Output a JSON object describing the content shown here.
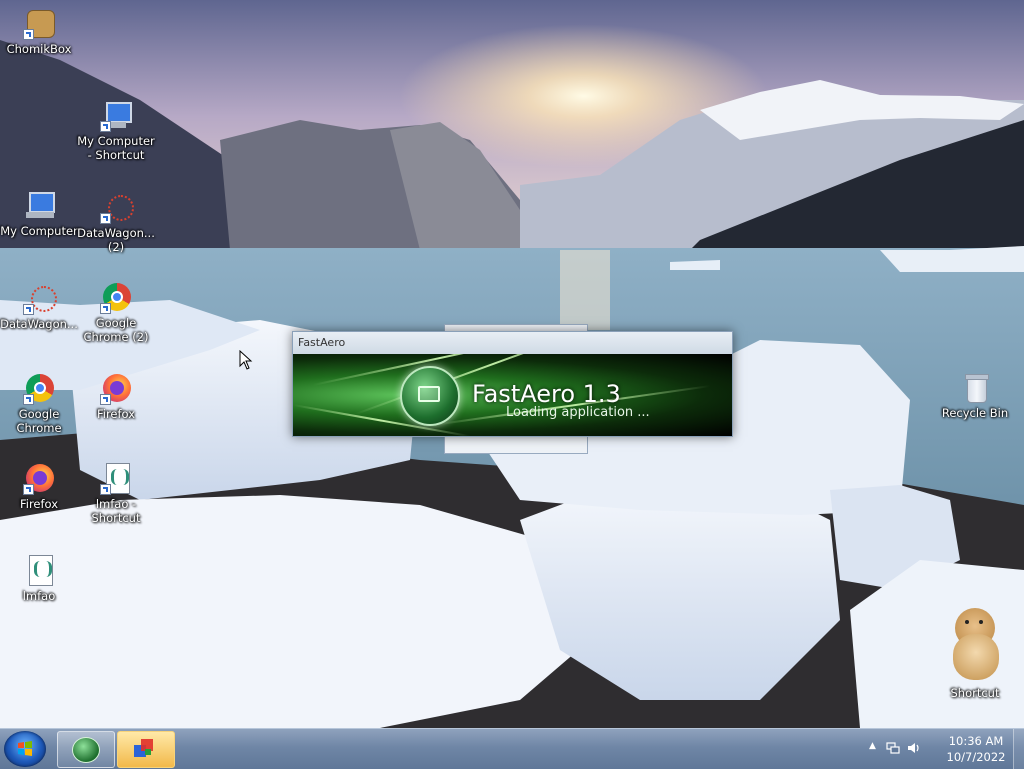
{
  "desktop": {
    "icons": [
      {
        "label": "ChomikBox",
        "icon": "hamster-icon"
      },
      {
        "label": "My Computer - Shortcut",
        "icon": "computer-icon"
      },
      {
        "label": "My Computer",
        "icon": "computer-icon"
      },
      {
        "label": "DataWagon... (2)",
        "icon": "datawagon-icon"
      },
      {
        "label": "DataWagon...",
        "icon": "datawagon-icon"
      },
      {
        "label": "Google Chrome (2)",
        "icon": "chrome-icon"
      },
      {
        "label": "Google Chrome",
        "icon": "chrome-icon"
      },
      {
        "label": "Firefox",
        "icon": "firefox-icon"
      },
      {
        "label": "Firefox",
        "icon": "firefox-icon"
      },
      {
        "label": "lmfao - Shortcut",
        "icon": "script-file-icon"
      },
      {
        "label": "lmfao",
        "icon": "script-file-icon"
      },
      {
        "label": "Recycle Bin",
        "icon": "recycle-bin-icon"
      },
      {
        "label": "Shortcut",
        "icon": "hamster-icon"
      }
    ]
  },
  "splash": {
    "title": "FastAero",
    "product": "FastAero 1.3",
    "status": "Loading application ..."
  },
  "taskbar": {
    "start_icon": "windows-logo-icon",
    "buttons": [
      {
        "name": "FastAero",
        "icon": "fastaero-icon"
      },
      {
        "name": "DataWagon",
        "icon": "datawagon-icon"
      }
    ],
    "tray": {
      "time": "10:36 AM",
      "date": "10/7/2022"
    }
  },
  "colors": {
    "taskbar": "#6f86a6",
    "splash_green": "#1f6d1d",
    "icon_text": "#ffffff"
  }
}
